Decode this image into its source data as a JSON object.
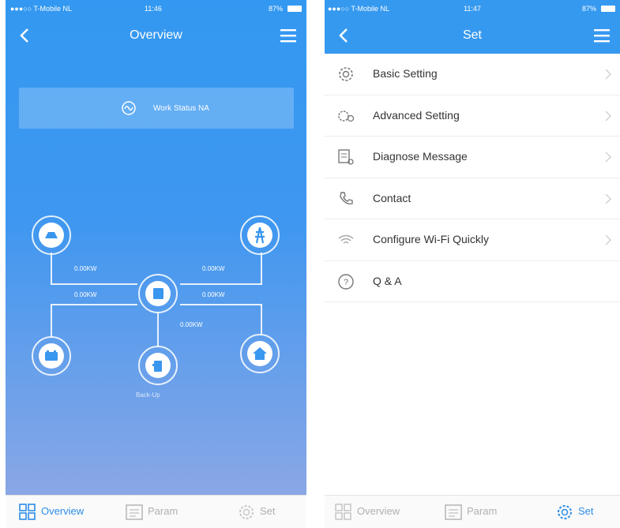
{
  "left_screen": {
    "status": {
      "carrier": "●●●○○ T-Mobile NL",
      "time": "11:46",
      "battery": "87%"
    },
    "title": "Overview",
    "work_status": "Work Status NA",
    "flows": {
      "pv": "0.00KW",
      "grid": "0.00KW",
      "battery": "0.00KW",
      "load": "0.00KW",
      "backup": "0.00KW"
    },
    "backup_label": "Back-Up",
    "tabs": [
      {
        "label": "Overview",
        "active": true
      },
      {
        "label": "Param",
        "active": false
      },
      {
        "label": "Set",
        "active": false
      }
    ]
  },
  "right_screen": {
    "status": {
      "carrier": "●●●○○ T-Mobile NL",
      "time": "11:47",
      "battery": "87%"
    },
    "title": "Set",
    "items": [
      {
        "label": "Basic Setting",
        "icon": "gear-icon",
        "chevron": true
      },
      {
        "label": "Advanced Setting",
        "icon": "gears-icon",
        "chevron": true
      },
      {
        "label": "Diagnose Message",
        "icon": "diagnose-icon",
        "chevron": true
      },
      {
        "label": "Contact",
        "icon": "phone-icon",
        "chevron": true
      },
      {
        "label": "Configure Wi-Fi Quickly",
        "icon": "wifi-icon",
        "chevron": true
      },
      {
        "label": "Q & A",
        "icon": "question-icon",
        "chevron": false
      }
    ],
    "tabs": [
      {
        "label": "Overview",
        "active": false
      },
      {
        "label": "Param",
        "active": false
      },
      {
        "label": "Set",
        "active": true
      }
    ]
  },
  "colors": {
    "accent": "#2c8de8",
    "header_blue": "#3699f0",
    "tab_inactive": "#b0b0b0"
  }
}
